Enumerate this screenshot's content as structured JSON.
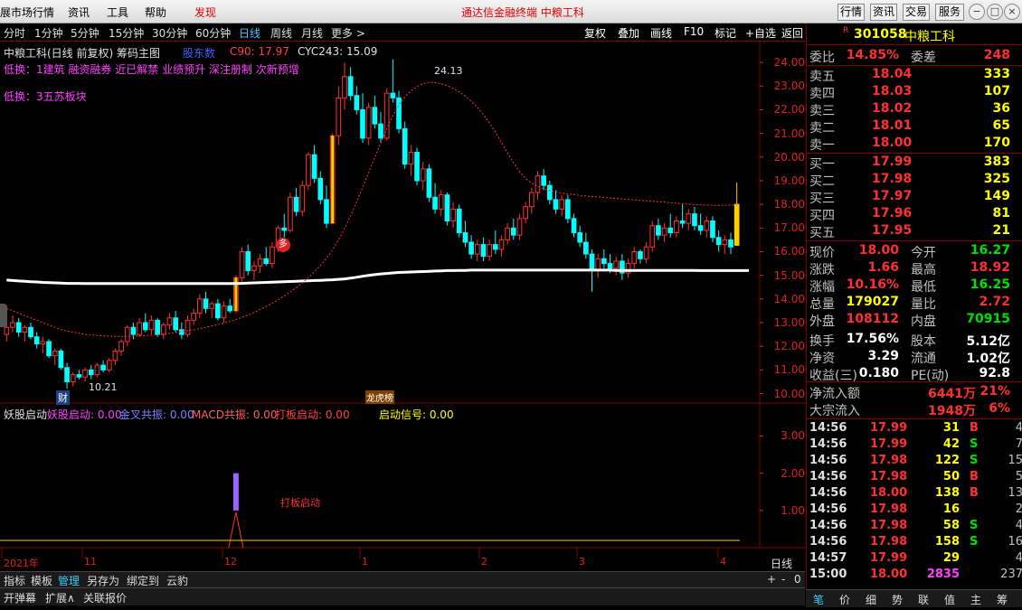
{
  "menubar": {
    "items": [
      "展市场行情",
      "资讯",
      "工具",
      "帮助"
    ],
    "discover": "发现",
    "center_title": "通达信金融终端  中粮工科",
    "right_buttons": [
      "行情",
      "资讯",
      "交易",
      "服务"
    ],
    "win_buttons": [
      "−",
      "□",
      "×"
    ]
  },
  "timeframes": {
    "items": [
      "分时",
      "1分钟",
      "5分钟",
      "15分钟",
      "30分钟",
      "60分钟",
      "日线",
      "周线",
      "月线",
      "更多 >"
    ],
    "active": "日线",
    "right_items": [
      "复权",
      "叠加",
      "画线",
      "F10",
      "标记",
      "+自选",
      "返回"
    ]
  },
  "chart": {
    "title": "中粮工科(日线 前复权) 筹码主图",
    "badge": "股东数",
    "c90": "C90: 17.97",
    "cyc": "CYC243: 15.09",
    "line1_label": "低换：",
    "line1_tags": "1建筑    融资融券 近已解禁 业绩预升 深注册制 次新预增",
    "line2_label": "低换：",
    "line2_tags": "3五苏板块",
    "high_label": "24.13",
    "low_label": "10.21",
    "cai_label": "财",
    "duo_label": "多",
    "bang_label": "龙虎榜",
    "y_axis": [
      "24.00",
      "23.00",
      "22.00",
      "21.00",
      "20.00",
      "19.00",
      "18.00",
      "17.00",
      "16.00",
      "15.00",
      "14.00",
      "13.00",
      "12.00",
      "11.00",
      "10.00"
    ],
    "x_axis": [
      "2021年",
      "11",
      "12",
      "1",
      "2",
      "3",
      "4"
    ],
    "candles": [
      [
        12.5,
        13.1,
        12.2,
        12.8
      ],
      [
        12.8,
        13.3,
        12.6,
        13.0
      ],
      [
        13.0,
        13.2,
        12.4,
        12.6
      ],
      [
        12.6,
        12.9,
        12.2,
        12.8
      ],
      [
        12.8,
        13.0,
        12.3,
        12.4
      ],
      [
        12.4,
        12.6,
        11.9,
        12.1
      ],
      [
        12.1,
        12.4,
        11.7,
        12.2
      ],
      [
        12.2,
        12.3,
        11.5,
        11.6
      ],
      [
        11.6,
        11.9,
        11.2,
        11.8
      ],
      [
        11.8,
        11.9,
        11.0,
        11.1
      ],
      [
        11.1,
        11.3,
        10.21,
        10.5
      ],
      [
        10.5,
        10.9,
        10.3,
        10.8
      ],
      [
        10.8,
        11.0,
        10.6,
        10.7
      ],
      [
        10.7,
        11.1,
        10.5,
        11.0
      ],
      [
        11.0,
        11.2,
        10.6,
        10.8
      ],
      [
        10.8,
        11.3,
        10.7,
        11.2
      ],
      [
        11.2,
        11.4,
        10.9,
        11.0
      ],
      [
        11.0,
        11.5,
        10.9,
        11.4
      ],
      [
        11.4,
        11.9,
        11.2,
        11.8
      ],
      [
        11.8,
        12.3,
        11.6,
        12.2
      ],
      [
        12.2,
        12.9,
        12.0,
        12.8
      ],
      [
        12.8,
        13.0,
        12.3,
        12.5
      ],
      [
        12.5,
        13.2,
        12.4,
        13.0
      ],
      [
        13.0,
        13.4,
        12.6,
        12.7
      ],
      [
        12.7,
        13.3,
        12.5,
        13.1
      ],
      [
        13.1,
        13.2,
        12.4,
        12.5
      ],
      [
        12.5,
        13.0,
        12.3,
        12.9
      ],
      [
        12.9,
        13.4,
        12.7,
        13.2
      ],
      [
        13.2,
        13.5,
        12.6,
        12.7
      ],
      [
        12.7,
        13.0,
        12.3,
        12.5
      ],
      [
        12.5,
        13.3,
        12.4,
        13.1
      ],
      [
        13.1,
        13.6,
        12.9,
        13.4
      ],
      [
        13.4,
        14.2,
        13.2,
        14.0
      ],
      [
        14.0,
        14.3,
        13.4,
        13.6
      ],
      [
        13.6,
        13.9,
        13.2,
        13.8
      ],
      [
        13.8,
        14.0,
        13.1,
        13.2
      ],
      [
        13.2,
        13.9,
        13.0,
        13.7
      ],
      [
        13.7,
        14.0,
        13.4,
        13.5
      ],
      [
        13.5,
        15.0,
        13.4,
        14.9
      ],
      [
        14.9,
        16.2,
        14.7,
        16.0
      ],
      [
        16.0,
        16.3,
        15.0,
        15.2
      ],
      [
        15.2,
        15.6,
        14.8,
        15.4
      ],
      [
        15.4,
        15.9,
        15.1,
        15.7
      ],
      [
        15.7,
        16.2,
        15.4,
        15.5
      ],
      [
        15.5,
        16.4,
        15.3,
        16.2
      ],
      [
        16.2,
        17.1,
        16.0,
        17.0
      ],
      [
        17.0,
        17.6,
        16.6,
        16.9
      ],
      [
        16.9,
        18.5,
        16.8,
        18.3
      ],
      [
        18.3,
        18.7,
        17.5,
        17.7
      ],
      [
        17.7,
        19.0,
        17.5,
        18.8
      ],
      [
        18.8,
        20.2,
        18.6,
        20.1
      ],
      [
        20.1,
        20.5,
        18.9,
        19.1
      ],
      [
        19.1,
        19.4,
        18.0,
        18.2
      ],
      [
        18.2,
        18.8,
        17.0,
        17.2
      ],
      [
        17.2,
        21.0,
        17.2,
        20.9
      ],
      [
        20.9,
        23.0,
        20.5,
        22.5
      ],
      [
        22.5,
        24.0,
        22.0,
        23.4
      ],
      [
        23.4,
        23.8,
        22.4,
        22.6
      ],
      [
        22.6,
        23.0,
        21.8,
        22.0
      ],
      [
        22.0,
        22.7,
        20.6,
        20.8
      ],
      [
        20.8,
        22.3,
        20.5,
        22.1
      ],
      [
        22.1,
        22.6,
        21.2,
        21.4
      ],
      [
        21.4,
        21.9,
        20.6,
        20.8
      ],
      [
        20.8,
        22.9,
        20.7,
        22.7
      ],
      [
        22.7,
        24.13,
        22.3,
        22.5
      ],
      [
        22.5,
        22.8,
        21.0,
        21.2
      ],
      [
        21.2,
        21.5,
        19.5,
        19.7
      ],
      [
        19.7,
        20.5,
        19.2,
        20.2
      ],
      [
        20.2,
        20.4,
        18.8,
        19.0
      ],
      [
        19.0,
        19.8,
        18.6,
        19.5
      ],
      [
        19.5,
        19.7,
        18.1,
        18.3
      ],
      [
        18.3,
        18.9,
        17.6,
        17.8
      ],
      [
        17.8,
        18.6,
        17.5,
        18.4
      ],
      [
        18.4,
        18.5,
        17.1,
        17.3
      ],
      [
        17.3,
        18.1,
        17.0,
        17.8
      ],
      [
        17.8,
        18.0,
        16.6,
        16.8
      ],
      [
        16.8,
        17.3,
        16.2,
        16.4
      ],
      [
        16.4,
        16.7,
        15.7,
        15.9
      ],
      [
        15.9,
        16.5,
        15.6,
        16.3
      ],
      [
        16.3,
        16.6,
        15.6,
        15.8
      ],
      [
        15.8,
        16.5,
        15.6,
        16.3
      ],
      [
        16.3,
        16.9,
        15.9,
        16.1
      ],
      [
        16.1,
        16.7,
        15.8,
        16.5
      ],
      [
        16.5,
        17.2,
        16.3,
        17.0
      ],
      [
        17.0,
        17.4,
        16.5,
        16.7
      ],
      [
        16.7,
        17.6,
        16.5,
        17.4
      ],
      [
        17.4,
        18.1,
        17.2,
        17.9
      ],
      [
        17.9,
        18.7,
        17.6,
        18.5
      ],
      [
        18.5,
        19.4,
        18.2,
        19.2
      ],
      [
        19.2,
        19.5,
        18.6,
        18.8
      ],
      [
        18.8,
        19.0,
        18.0,
        18.2
      ],
      [
        18.2,
        18.6,
        17.6,
        17.8
      ],
      [
        17.8,
        18.4,
        17.5,
        18.2
      ],
      [
        18.2,
        18.4,
        17.2,
        17.4
      ],
      [
        17.4,
        17.6,
        16.6,
        16.8
      ],
      [
        16.8,
        17.1,
        16.2,
        16.4
      ],
      [
        16.4,
        16.8,
        15.7,
        15.9
      ],
      [
        15.9,
        16.1,
        14.3,
        15.2
      ],
      [
        15.2,
        15.9,
        14.9,
        15.7
      ],
      [
        15.7,
        16.1,
        15.3,
        15.5
      ],
      [
        15.5,
        15.9,
        15.1,
        15.3
      ],
      [
        15.3,
        15.8,
        15.0,
        15.6
      ],
      [
        15.6,
        15.9,
        14.8,
        15.1
      ],
      [
        15.1,
        15.7,
        14.9,
        15.5
      ],
      [
        15.5,
        16.2,
        15.3,
        16.0
      ],
      [
        16.0,
        16.1,
        15.5,
        15.7
      ],
      [
        15.7,
        16.4,
        15.5,
        16.2
      ],
      [
        16.2,
        17.3,
        16.0,
        17.1
      ],
      [
        17.1,
        17.4,
        16.5,
        16.7
      ],
      [
        16.7,
        17.2,
        16.4,
        17.0
      ],
      [
        17.0,
        17.6,
        16.6,
        16.8
      ],
      [
        16.8,
        17.5,
        16.6,
        17.3
      ],
      [
        17.3,
        18.0,
        17.0,
        17.2
      ],
      [
        17.2,
        17.8,
        16.9,
        17.6
      ],
      [
        17.6,
        17.9,
        16.9,
        17.1
      ],
      [
        17.1,
        17.6,
        16.7,
        16.9
      ],
      [
        16.9,
        17.5,
        16.6,
        17.3
      ],
      [
        17.3,
        17.5,
        16.4,
        16.6
      ],
      [
        16.6,
        16.9,
        16.0,
        16.3
      ],
      [
        16.3,
        16.7,
        15.9,
        16.5
      ],
      [
        16.5,
        16.8,
        15.9,
        16.2
      ],
      [
        16.27,
        18.92,
        16.25,
        18.0
      ]
    ],
    "ma_white": [
      14.8,
      14.78,
      14.76,
      14.75,
      14.73,
      14.72,
      14.7,
      14.69,
      14.68,
      14.67,
      14.66,
      14.66,
      14.66,
      14.65,
      14.65,
      14.65,
      14.65,
      14.65,
      14.65,
      14.65,
      14.65,
      14.65,
      14.65,
      14.65,
      14.65,
      14.65,
      14.65,
      14.65,
      14.65,
      14.65,
      14.65,
      14.65,
      14.65,
      14.65,
      14.65,
      14.65,
      14.65,
      14.65,
      14.65,
      14.66,
      14.67,
      14.68,
      14.69,
      14.7,
      14.71,
      14.72,
      14.73,
      14.74,
      14.75,
      14.76,
      14.77,
      14.78,
      14.79,
      14.8,
      14.81,
      14.83,
      14.85,
      14.88,
      14.92,
      14.96,
      15.0,
      15.03,
      15.06,
      15.08,
      15.1,
      15.12,
      15.13,
      15.14,
      15.15,
      15.16,
      15.17,
      15.18,
      15.19,
      15.2,
      15.2,
      15.21,
      15.21,
      15.22,
      15.22,
      15.22,
      15.22,
      15.22,
      15.22,
      15.22,
      15.22,
      15.22,
      15.22,
      15.22,
      15.22,
      15.22,
      15.22,
      15.22,
      15.22,
      15.22,
      15.22,
      15.22,
      15.22,
      15.22,
      15.22,
      15.22,
      15.22,
      15.21,
      15.21,
      15.21,
      15.21,
      15.21,
      15.21,
      15.21,
      15.21,
      15.21,
      15.21,
      15.21,
      15.21,
      15.21,
      15.21,
      15.2,
      15.2,
      15.2,
      15.2,
      15.2,
      15.2,
      15.2,
      15.2,
      15.2
    ],
    "ma_red": [
      13.6,
      13.5,
      13.4,
      13.3,
      13.2,
      13.1,
      13.0,
      12.9,
      12.8,
      12.7,
      12.65,
      12.6,
      12.55,
      12.5,
      12.48,
      12.46,
      12.44,
      12.43,
      12.42,
      12.42,
      12.42,
      12.43,
      12.44,
      12.45,
      12.47,
      12.49,
      12.52,
      12.55,
      12.58,
      12.62,
      12.66,
      12.7,
      12.75,
      12.8,
      12.86,
      12.92,
      12.98,
      13.05,
      13.13,
      13.22,
      13.32,
      13.43,
      13.55,
      13.68,
      13.82,
      13.97,
      14.13,
      14.3,
      14.48,
      14.68,
      14.9,
      15.15,
      15.42,
      15.72,
      16.08,
      16.5,
      16.98,
      17.52,
      18.1,
      18.72,
      19.35,
      19.98,
      20.6,
      21.2,
      21.75,
      22.2,
      22.55,
      22.8,
      22.98,
      23.1,
      23.15,
      23.15,
      23.1,
      23.02,
      22.9,
      22.76,
      22.58,
      22.36,
      22.1,
      21.8,
      21.45,
      21.05,
      20.62,
      20.18,
      19.76,
      19.38,
      19.1,
      18.9,
      18.76,
      18.66,
      18.58,
      18.52,
      18.48,
      18.44,
      18.41,
      18.38,
      18.35,
      18.33,
      18.31,
      18.29,
      18.27,
      18.25,
      18.23,
      18.21,
      18.19,
      18.17,
      18.15,
      18.13,
      18.11,
      18.09,
      18.07,
      18.05,
      18.03,
      18.01,
      17.99,
      17.98,
      17.97,
      17.96,
      17.96,
      17.96,
      17.97,
      17.97
    ],
    "indicator_title": "妖股启动",
    "indicator_items": [
      {
        "label": "妖股启动: 0.00",
        "color": "#ff40ff"
      },
      {
        "label": "金叉共振: 0.00",
        "color": "#8080ff"
      },
      {
        "label": "MACD共振: 0.00",
        "color": "#ff6060"
      },
      {
        "label": "打板启动: 0.00",
        "color": "#ff4040"
      },
      {
        "label": "启动信号: 0.00",
        "color": "#ffff00"
      }
    ],
    "indicator_y": [
      "3.00",
      "2.00",
      "1.00"
    ],
    "board_label": "打板启动",
    "period_label": "日线"
  },
  "bottombar": {
    "items": [
      "指标",
      "模板",
      "管理",
      "另存为",
      "绑定到",
      "云豹"
    ],
    "active": "管理",
    "ctrl": [
      "+",
      "-",
      "0"
    ],
    "items2": [
      "开弹幕",
      "扩展∧",
      "关联报价"
    ]
  },
  "quote": {
    "code": "301058",
    "name": "中粮工科",
    "r_mark": "R",
    "weibi_label": "委比",
    "weibi": "14.85%",
    "weicha_label": "委差",
    "weicha": "248",
    "asks": [
      {
        "label": "卖五",
        "price": "18.04",
        "vol": "333"
      },
      {
        "label": "卖四",
        "price": "18.03",
        "vol": "107"
      },
      {
        "label": "卖三",
        "price": "18.02",
        "vol": "36"
      },
      {
        "label": "卖二",
        "price": "18.01",
        "vol": "65"
      },
      {
        "label": "卖一",
        "price": "18.00",
        "vol": "170"
      }
    ],
    "bids": [
      {
        "label": "买一",
        "price": "17.99",
        "vol": "383"
      },
      {
        "label": "买二",
        "price": "17.98",
        "vol": "325"
      },
      {
        "label": "买三",
        "price": "17.97",
        "vol": "149"
      },
      {
        "label": "买四",
        "price": "17.96",
        "vol": "81"
      },
      {
        "label": "买五",
        "price": "17.95",
        "vol": "21"
      }
    ],
    "stats": [
      {
        "l1": "现价",
        "v1": "18.00",
        "c1": "red",
        "l2": "今开",
        "v2": "16.27",
        "c2": "grn"
      },
      {
        "l1": "涨跌",
        "v1": "1.66",
        "c1": "red",
        "l2": "最高",
        "v2": "18.92",
        "c2": "red"
      },
      {
        "l1": "涨幅",
        "v1": "10.16%",
        "c1": "red",
        "l2": "最低",
        "v2": "16.25",
        "c2": "grn"
      },
      {
        "l1": "总量",
        "v1": "179027",
        "c1": "yel",
        "l2": "量比",
        "v2": "2.72",
        "c2": "red"
      },
      {
        "l1": "外盘",
        "v1": "108112",
        "c1": "red",
        "l2": "内盘",
        "v2": "70915",
        "c2": "grn"
      },
      {
        "l1": "换手",
        "v1": "17.56%",
        "c1": "wht",
        "l2": "股本",
        "v2": "5.12亿",
        "c2": "wht"
      },
      {
        "l1": "净资",
        "v1": "3.29",
        "c1": "wht",
        "l2": "流通",
        "v2": "1.02亿",
        "c2": "wht"
      },
      {
        "l1": "收益(三)",
        "v1": "0.180",
        "c1": "wht",
        "l2": "PE(动)",
        "v2": "92.8",
        "c2": "wht"
      }
    ],
    "flow": [
      {
        "label": "净流入额",
        "value": "6441万",
        "pct": "21%"
      },
      {
        "label": "大宗流入",
        "value": "1948万",
        "pct": "6%"
      }
    ],
    "ticks": [
      {
        "t": "14:56",
        "p": "17.99",
        "v": "31",
        "bs": "B",
        "n": "4"
      },
      {
        "t": "14:56",
        "p": "17.99",
        "v": "42",
        "bs": "S",
        "n": "7"
      },
      {
        "t": "14:56",
        "p": "17.98",
        "v": "122",
        "bs": "S",
        "n": "15"
      },
      {
        "t": "14:56",
        "p": "17.98",
        "v": "50",
        "bs": "B",
        "n": "5"
      },
      {
        "t": "14:56",
        "p": "18.00",
        "v": "138",
        "bs": "B",
        "n": "13"
      },
      {
        "t": "14:56",
        "p": "17.98",
        "v": "16",
        "bs": "",
        "n": "2"
      },
      {
        "t": "14:56",
        "p": "17.98",
        "v": "58",
        "bs": "S",
        "n": "4"
      },
      {
        "t": "14:56",
        "p": "17.98",
        "v": "158",
        "bs": "S",
        "n": "16"
      },
      {
        "t": "14:57",
        "p": "17.99",
        "v": "29",
        "bs": "",
        "n": "4"
      },
      {
        "t": "15:00",
        "p": "18.00",
        "v": "2835",
        "bs": "",
        "n": "237"
      }
    ],
    "tabs": [
      "笔",
      "价",
      "细",
      "势",
      "联",
      "值",
      "主",
      "筹"
    ]
  }
}
